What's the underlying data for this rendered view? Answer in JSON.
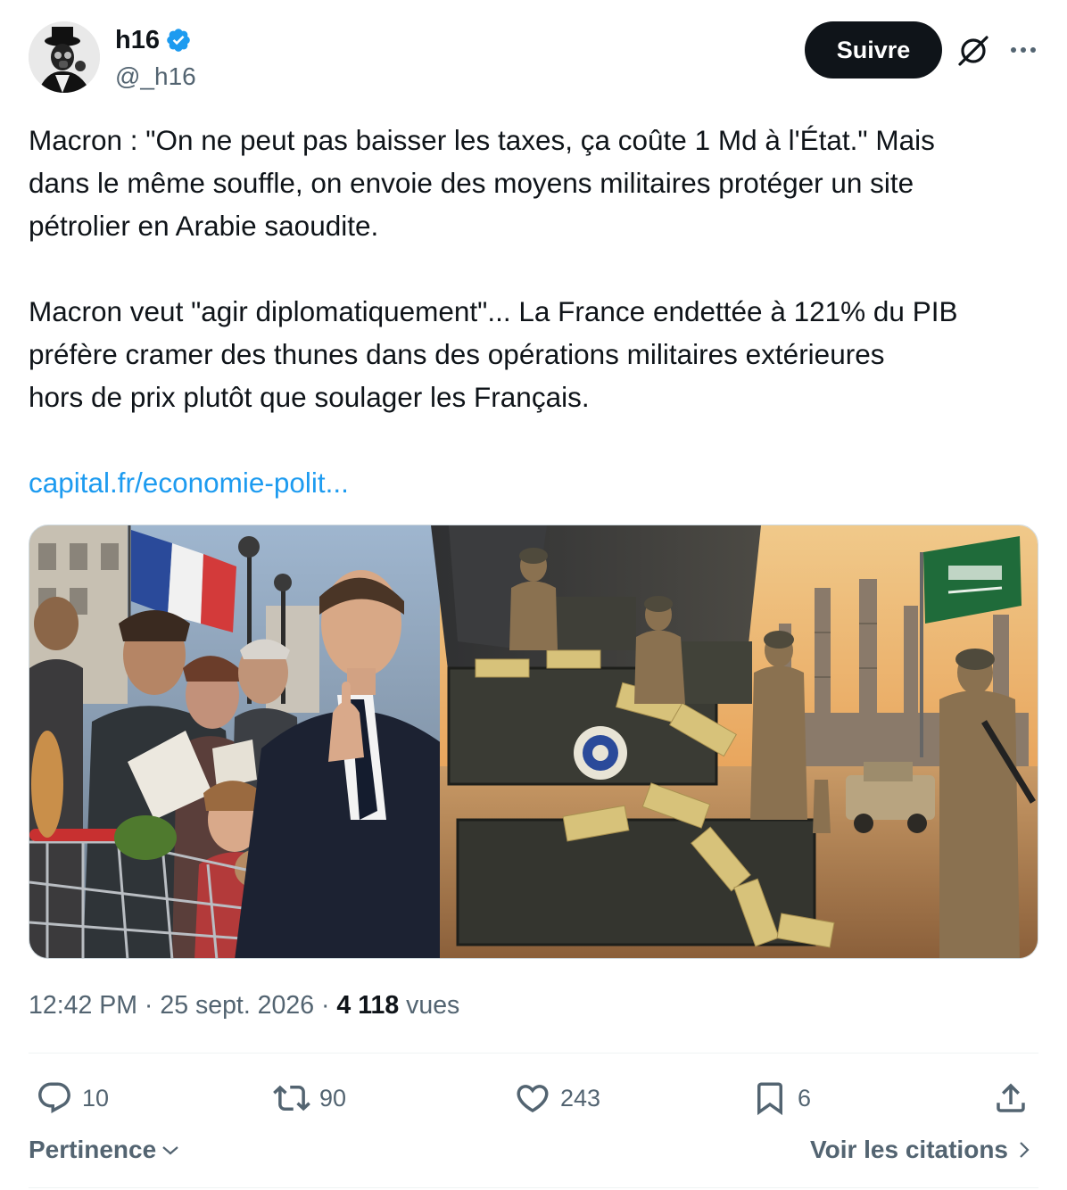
{
  "author": {
    "display_name": "h16",
    "handle": "@_h16",
    "verified": true,
    "verified_color": "#1d9bf0"
  },
  "header": {
    "follow_label": "Suivre",
    "grok_icon": "grok-icon",
    "more_icon": "more-icon"
  },
  "tweet": {
    "paragraph1": [
      "Macron : \"On ne peut pas baisser les taxes, ça coûte 1 Md à  l'État.\" Mais",
      "dans le même souffle, on envoie des moyens militaires protéger un site",
      "pétrolier en Arabie saoudite."
    ],
    "paragraph2": [
      "Macron veut \"agir diplomatiquement\"... La France endettée à 121% du PIB",
      "préfère cramer des thunes dans des opérations militaires extérieures",
      "hors de prix plutôt que soulager les Français."
    ],
    "link": "capital.fr/economie-polit...",
    "link_color": "#1d9bf0"
  },
  "meta": {
    "time": "12:42 PM",
    "separator": "·",
    "date": "25 sept. 2026",
    "views_count": "4 118",
    "views_label": "vues"
  },
  "actions": {
    "replies": "10",
    "reposts": "90",
    "likes": "243",
    "bookmarks": "6"
  },
  "footer": {
    "sort_label": "Pertinence",
    "quotes_label": "Voir les citations"
  }
}
